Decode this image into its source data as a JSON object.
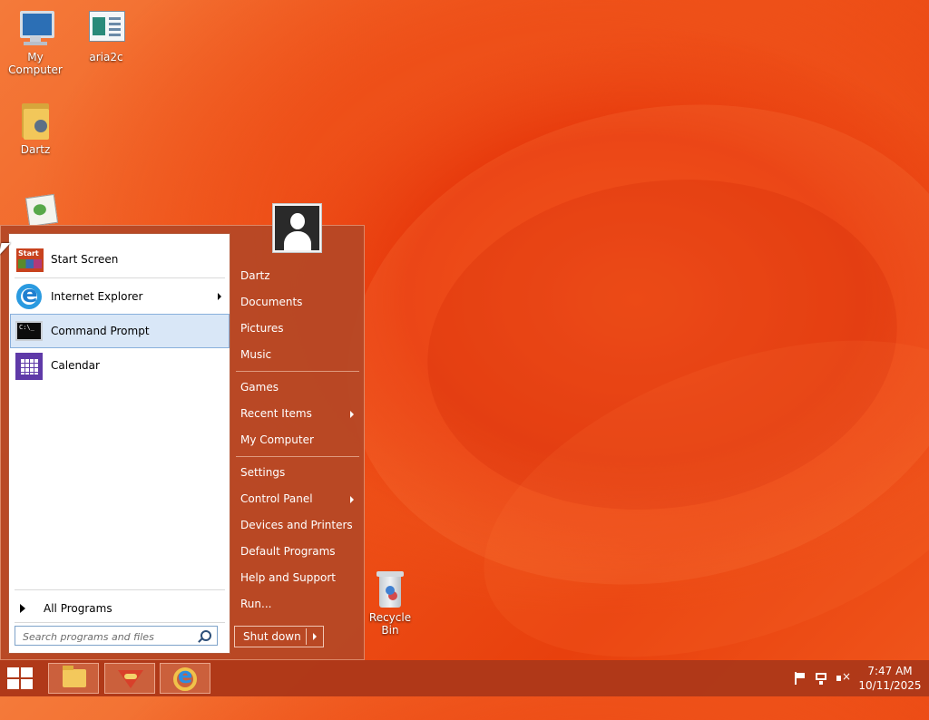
{
  "desktop": {
    "icons": [
      {
        "label": "My Computer",
        "icon": "computer-icon"
      },
      {
        "label": "aria2c",
        "icon": "application-icon"
      },
      {
        "label": "Dartz",
        "icon": "user-folder-icon"
      },
      {
        "label": "",
        "icon": "notepad-icon"
      },
      {
        "label": "Recycle Bin",
        "icon": "recycle-bin-icon"
      }
    ]
  },
  "start_menu": {
    "programs": [
      {
        "label": "Start Screen",
        "icon": "start-screen-icon",
        "has_submenu": false
      },
      {
        "label": "Internet Explorer",
        "icon": "internet-explorer-icon",
        "has_submenu": true
      },
      {
        "label": "Command Prompt",
        "icon": "command-prompt-icon",
        "has_submenu": false,
        "selected": true
      },
      {
        "label": "Calendar",
        "icon": "calendar-icon",
        "has_submenu": false
      }
    ],
    "all_programs": "All Programs",
    "search": {
      "placeholder": "Search programs and files",
      "value": ""
    },
    "user_icon": "user-avatar-icon",
    "right_items": [
      {
        "label": "Dartz",
        "has_submenu": false
      },
      {
        "label": "Documents",
        "has_submenu": false
      },
      {
        "label": "Pictures",
        "has_submenu": false
      },
      {
        "label": "Music",
        "has_submenu": false
      },
      {
        "label": "Games",
        "has_submenu": false
      },
      {
        "label": "Recent Items",
        "has_submenu": true
      },
      {
        "label": "My Computer",
        "has_submenu": false
      },
      {
        "label": "Settings",
        "has_submenu": false
      },
      {
        "label": "Control Panel",
        "has_submenu": true
      },
      {
        "label": "Devices and Printers",
        "has_submenu": false
      },
      {
        "label": "Default Programs",
        "has_submenu": false
      },
      {
        "label": "Help and Support",
        "has_submenu": false
      },
      {
        "label": "Run...",
        "has_submenu": false
      }
    ],
    "shutdown": {
      "label": "Shut down"
    }
  },
  "taskbar": {
    "pinned": [
      {
        "name": "file-explorer",
        "icon": "folder-icon"
      },
      {
        "name": "app",
        "icon": "fox-icon"
      },
      {
        "name": "internet-explorer",
        "icon": "internet-explorer-icon"
      }
    ],
    "tray_icons": [
      "flag-icon",
      "network-icon",
      "volume-muted-icon"
    ],
    "clock": {
      "time": "7:47 AM",
      "date": "10/11/2025"
    }
  },
  "colors": {
    "wallpaper": "#ef5316",
    "start_menu_bg": "#b44826",
    "taskbar": "#aa3719",
    "selection": "#d9e7f7"
  }
}
